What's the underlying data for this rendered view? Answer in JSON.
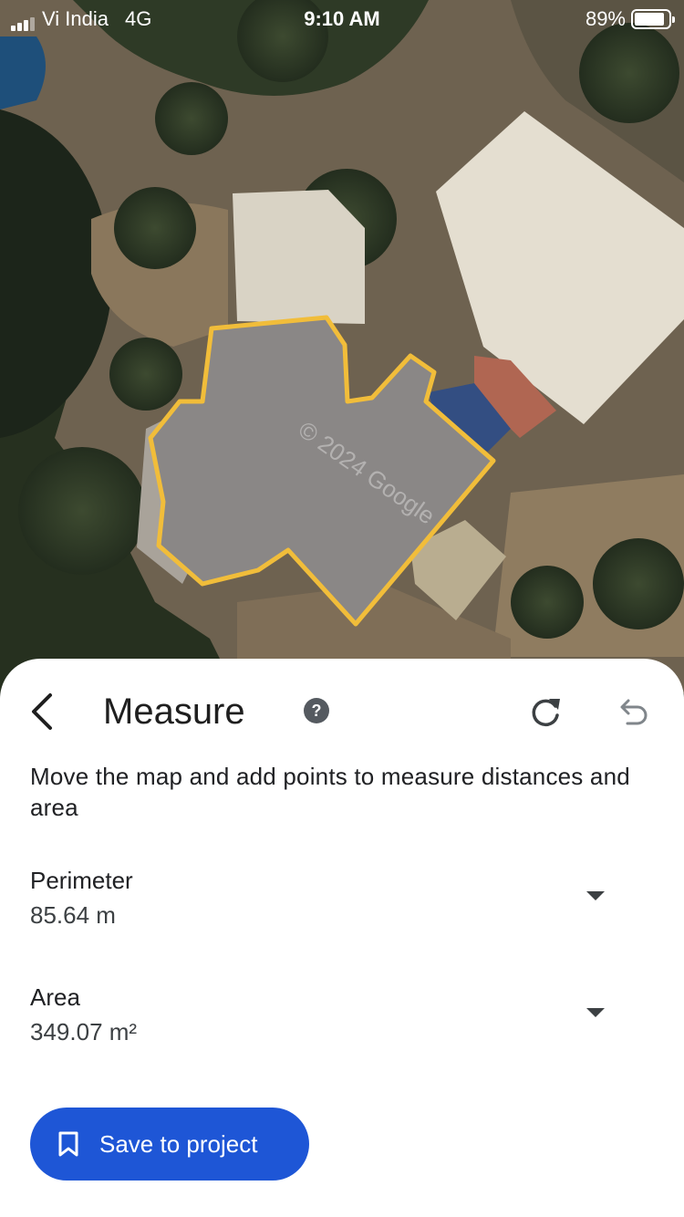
{
  "status_bar": {
    "carrier": "Vi India",
    "network": "4G",
    "time": "9:10 AM",
    "battery_percent": "89%",
    "battery_level": 0.89,
    "signal_bars_filled": 3,
    "signal_bars_total": 4
  },
  "map": {
    "watermark": "© 2024 Google",
    "outline_color": "#f1bd3a"
  },
  "sheet": {
    "title": "Measure",
    "instructions": "Move the map and add points to measure distances and area",
    "perimeter": {
      "label": "Perimeter",
      "value": "85.64 m"
    },
    "area": {
      "label": "Area",
      "value": "349.07 m²"
    },
    "save_button_label": "Save to project",
    "icons": {
      "back": "chevron-left-icon",
      "help": "help-circle-icon",
      "redo": "redo-icon",
      "undo": "undo-icon",
      "dropdown": "caret-down-icon",
      "bookmark": "bookmark-icon"
    },
    "accent_color": "#1e56d6"
  }
}
